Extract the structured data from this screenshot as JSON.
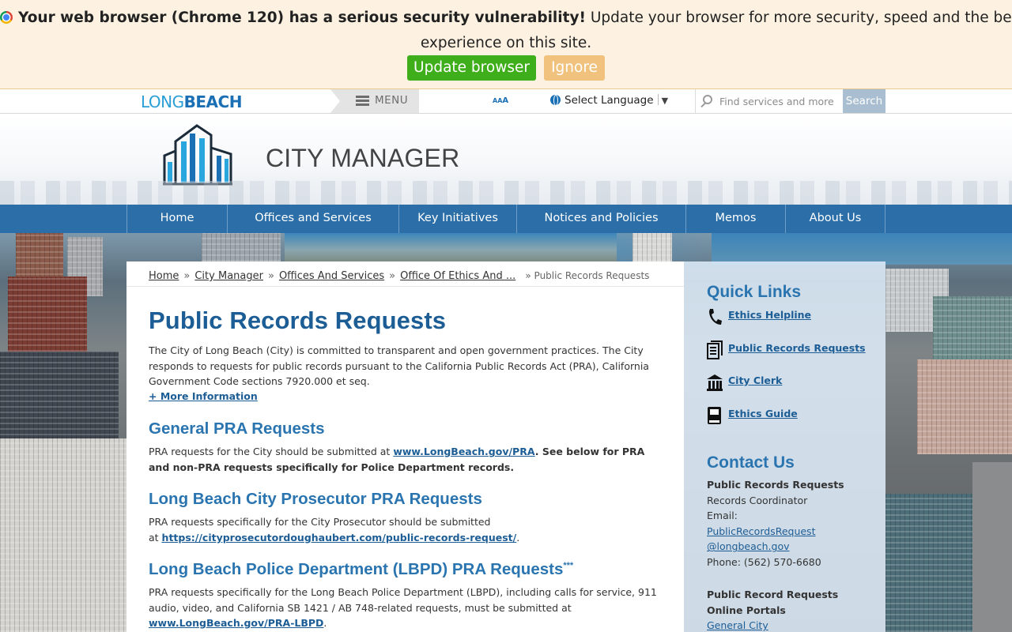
{
  "banner": {
    "bold_text": "Your web browser (Chrome 120) has a serious security vulnerability!",
    "rest_text_line1": " Update your browser for more security, speed and the best",
    "rest_text_line2": "experience on this site.",
    "update_label": "Update browser",
    "ignore_label": "Ignore"
  },
  "utility": {
    "logo_part1": "LONG",
    "logo_part2": "BEACH",
    "menu_label": "MENU",
    "text_size_small": "A",
    "text_size_medium": "A",
    "text_size_large": "A",
    "language_label": "Select Language",
    "language_arrow": "▼",
    "search_placeholder": "Find services and more",
    "search_button": "Search"
  },
  "header": {
    "title": "CITY MANAGER"
  },
  "nav": {
    "items": [
      {
        "label": "Home"
      },
      {
        "label": "Offices and Services"
      },
      {
        "label": "Key Initiatives"
      },
      {
        "label": "Notices and Policies"
      },
      {
        "label": "Memos"
      },
      {
        "label": "About Us"
      }
    ]
  },
  "breadcrumb": {
    "items": [
      "Home",
      "City Manager",
      "Offices And Services",
      "Office Of Ethics And ..."
    ],
    "separator": "»",
    "current": "» Public Records Requests"
  },
  "main": {
    "title": "Public Records Requests",
    "intro": "The City of Long Beach (City) is committed to transparent and open government practices. The City responds to requests for public records pursuant to the California Public Records Act (PRA), California Government Code sections 7920.000 et seq.",
    "more_info": "+ More Information",
    "section1": {
      "heading": "General PRA Requests",
      "text_before": "PRA requests for the City should be submitted at ",
      "link": "www.LongBeach.gov/PRA",
      "text_bold": ". See below for PRA and non-PRA requests specifically for Police Department records."
    },
    "section2": {
      "heading": "Long Beach City Prosecutor PRA Requests",
      "text_before": "PRA requests specifically for the City Prosecutor should be submitted",
      "text_at": "at ",
      "link": "https://cityprosecutordoughaubert.com/public-records-request/",
      "text_after": "."
    },
    "section3": {
      "heading": "Long Beach Police Department (LBPD) PRA Requests",
      "heading_sup": "***",
      "text_before": "PRA requests specifically for the Long Beach Police Department (LBPD), including calls for service, 911 audio, video, and California SB 1421 / AB 748-related requests, must be submitted at ",
      "link": "www.LongBeach.gov/PRA-LBPD",
      "text_after": "."
    }
  },
  "sidebar": {
    "quick_links_heading": "Quick Links",
    "quick_links": [
      {
        "label": "Ethics Helpline",
        "icon": "phone-icon"
      },
      {
        "label": "Public Records Requests",
        "icon": "document-icon"
      },
      {
        "label": "City Clerk",
        "icon": "building-icon"
      },
      {
        "label": "Ethics Guide",
        "icon": "book-icon"
      }
    ],
    "contact_heading": "Contact Us",
    "contact_title": "Public Records Requests",
    "contact_role": "Records Coordinator",
    "email_label": "Email:",
    "email_part1": "PublicRecordsRequest",
    "email_part2": "@longbeach.gov",
    "phone": "Phone: (562) 570-6680",
    "portals_heading": "Public Record Requests Online Portals",
    "portal_link": "General City"
  },
  "colors": {
    "brand_blue": "#2c6fa8",
    "heading_blue": "#1d5d95",
    "banner_bg": "#fdf2e1",
    "update_green": "#3fae1b",
    "ignore_orange": "#f1c27d"
  }
}
